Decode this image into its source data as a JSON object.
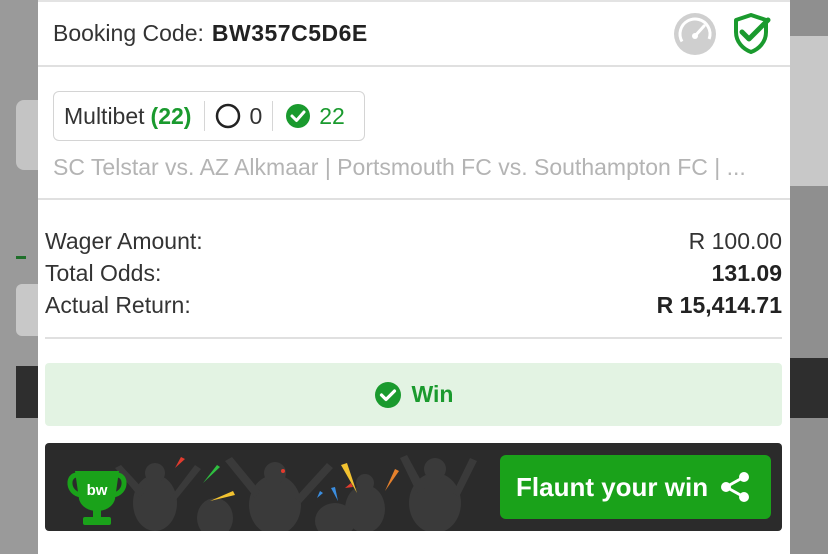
{
  "booking": {
    "label": "Booking Code:",
    "code": "BW357C5D6E"
  },
  "multibet": {
    "label": "Multibet",
    "count": "(22)",
    "open_count": "0",
    "won_count": "22"
  },
  "matches_text": "SC Telstar vs. AZ Alkmaar | Portsmouth FC vs. Southampton FC | ...",
  "summary": {
    "wager_label": "Wager Amount:",
    "wager_value": "R 100.00",
    "odds_label": "Total Odds:",
    "odds_value": "131.09",
    "return_label": "Actual Return:",
    "return_value": "R 15,414.71"
  },
  "status": {
    "label": "Win"
  },
  "flaunt": {
    "button_label": "Flaunt your win",
    "trophy_text": "bw"
  },
  "colors": {
    "accent_green": "#1a9a2e",
    "win_bg": "#e3f3e3",
    "banner_dark": "#2b2b2b"
  }
}
